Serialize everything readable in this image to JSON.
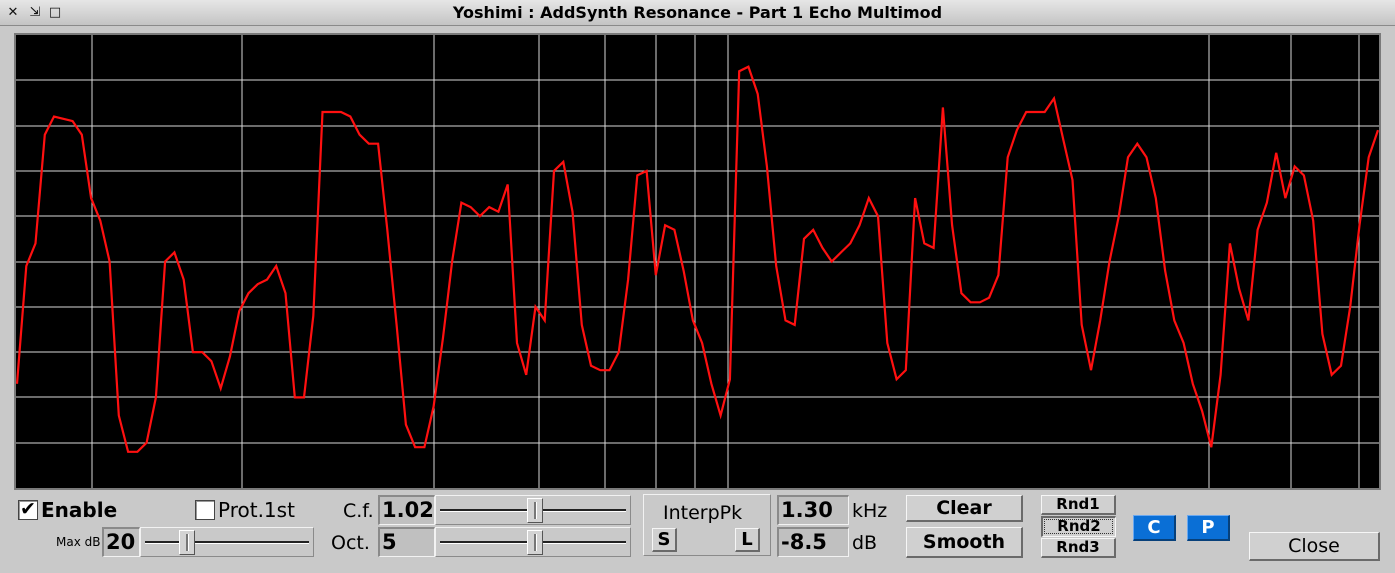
{
  "window": {
    "title": "Yoshimi : AddSynth Resonance - Part 1 Echo Multimod",
    "close_glyph": "✕",
    "pin_glyph": "⇲",
    "maximize_glyph": "□"
  },
  "graph": {
    "background": "#000000",
    "grid_color": "#d8d8d8",
    "curve_color": "#ff1010",
    "curve_y_fraction": [
      0.77,
      0.51,
      0.46,
      0.22,
      0.18,
      0.185,
      0.19,
      0.22,
      0.36,
      0.41,
      0.5,
      0.84,
      0.92,
      0.92,
      0.9,
      0.8,
      0.5,
      0.48,
      0.54,
      0.7,
      0.7,
      0.72,
      0.78,
      0.71,
      0.61,
      0.57,
      0.55,
      0.54,
      0.51,
      0.57,
      0.8,
      0.8,
      0.62,
      0.17,
      0.17,
      0.17,
      0.18,
      0.22,
      0.24,
      0.24,
      0.43,
      0.64,
      0.86,
      0.91,
      0.91,
      0.82,
      0.67,
      0.5,
      0.37,
      0.38,
      0.4,
      0.38,
      0.39,
      0.33,
      0.68,
      0.75,
      0.6,
      0.63,
      0.3,
      0.28,
      0.39,
      0.64,
      0.73,
      0.74,
      0.74,
      0.7,
      0.54,
      0.31,
      0.3,
      0.53,
      0.42,
      0.43,
      0.52,
      0.63,
      0.68,
      0.77,
      0.84,
      0.76,
      0.08,
      0.07,
      0.13,
      0.29,
      0.51,
      0.63,
      0.64,
      0.45,
      0.43,
      0.47,
      0.5,
      0.48,
      0.46,
      0.42,
      0.36,
      0.4,
      0.68,
      0.76,
      0.74,
      0.36,
      0.46,
      0.47,
      0.16,
      0.42,
      0.57,
      0.59,
      0.59,
      0.58,
      0.53,
      0.27,
      0.21,
      0.17,
      0.17,
      0.17,
      0.14,
      0.23,
      0.32,
      0.64,
      0.74,
      0.63,
      0.5,
      0.4,
      0.27,
      0.24,
      0.27,
      0.36,
      0.52,
      0.63,
      0.68,
      0.77,
      0.83,
      0.91,
      0.75,
      0.46,
      0.56,
      0.63,
      0.43,
      0.37,
      0.26,
      0.36,
      0.29,
      0.31,
      0.41,
      0.66,
      0.75,
      0.73,
      0.6,
      0.42,
      0.27,
      0.21
    ]
  },
  "enable": {
    "label": "Enable",
    "checked": true,
    "check_glyph": "✔"
  },
  "prot1st": {
    "label": "Prot.1st",
    "checked": false
  },
  "maxdb": {
    "label": "Max dB",
    "value": "20",
    "slider_fraction": 0.24
  },
  "cf": {
    "label": "C.f.",
    "value": "1.02",
    "slider_fraction": 0.51
  },
  "oct": {
    "label": "Oct.",
    "value": "5",
    "slider_fraction": 0.51
  },
  "interp": {
    "label": "InterpPk",
    "s_label": "S",
    "l_label": "L"
  },
  "freq": {
    "value": "1.30",
    "unit": "kHz"
  },
  "db": {
    "value": "-8.5",
    "unit": "dB"
  },
  "buttons": {
    "clear": "Clear",
    "smooth": "Smooth",
    "rnd1": "Rnd1",
    "rnd2": "Rnd2",
    "rnd3": "Rnd3",
    "c": "C",
    "p": "P",
    "close": "Close"
  },
  "colors": {
    "accent_blue": "#0a6fd6",
    "panel": "#c9c9c9"
  }
}
